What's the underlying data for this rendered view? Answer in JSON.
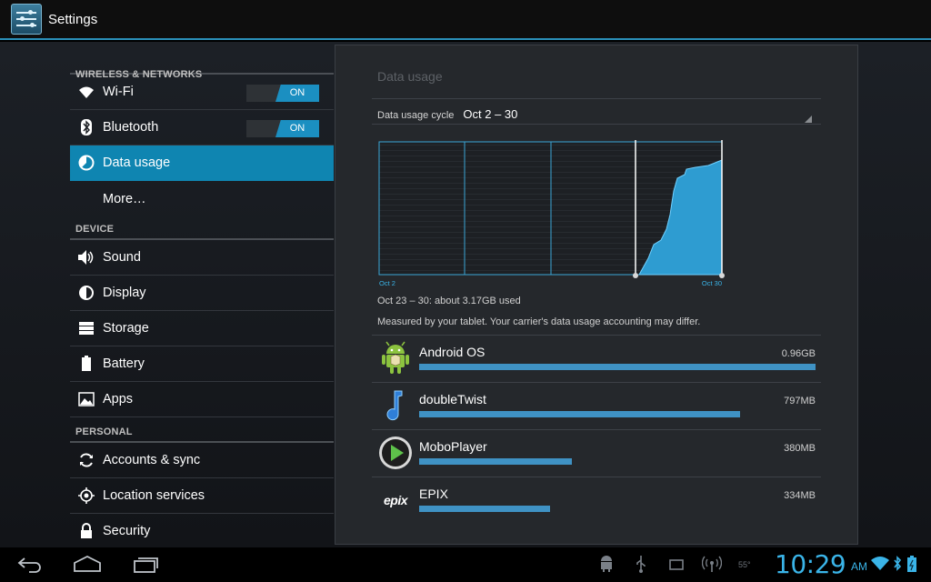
{
  "actionbar": {
    "title": "Settings"
  },
  "sections": {
    "wireless": "WIRELESS & NETWORKS",
    "device": "DEVICE",
    "personal": "PERSONAL"
  },
  "items": {
    "wifi": {
      "label": "Wi-Fi",
      "toggle": "ON"
    },
    "bluetooth": {
      "label": "Bluetooth",
      "toggle": "ON"
    },
    "data_usage": {
      "label": "Data usage"
    },
    "more": {
      "label": "More…"
    },
    "sound": {
      "label": "Sound"
    },
    "display": {
      "label": "Display"
    },
    "storage": {
      "label": "Storage"
    },
    "battery": {
      "label": "Battery"
    },
    "apps": {
      "label": "Apps"
    },
    "accounts": {
      "label": "Accounts & sync"
    },
    "location": {
      "label": "Location services"
    },
    "security": {
      "label": "Security"
    }
  },
  "panel": {
    "title": "Data usage",
    "cycle_label": "Data usage cycle",
    "cycle_value": "Oct 2 – 30",
    "chart_start": "Oct 2",
    "chart_end": "Oct 30",
    "summary": "Oct 23 – 30: about 3.17GB used",
    "measured_note": "Measured by your tablet. Your carrier's data usage accounting may differ."
  },
  "apps": [
    {
      "name": "Android OS",
      "size": "0.96GB",
      "fraction": 1.0,
      "icon": "android-icon"
    },
    {
      "name": "doubleTwist",
      "size": "797MB",
      "fraction": 0.81,
      "icon": "music-note-icon"
    },
    {
      "name": "MoboPlayer",
      "size": "380MB",
      "fraction": 0.385,
      "icon": "play-icon"
    },
    {
      "name": "EPIX",
      "size": "334MB",
      "fraction": 0.33,
      "icon": "epix-logo-icon",
      "logo_text": "epix"
    }
  ],
  "statusbar": {
    "time": "10:29",
    "ampm": "AM",
    "temp": "55°"
  },
  "colors": {
    "accent": "#0f85b1",
    "clock": "#3ab4e8",
    "bar": "#3f92c4"
  }
}
